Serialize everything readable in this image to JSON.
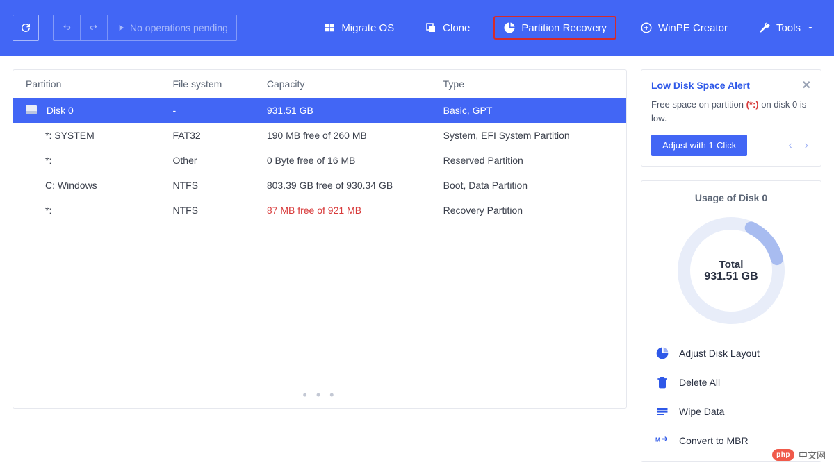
{
  "toolbar": {
    "pending": "No operations pending",
    "migrate": "Migrate OS",
    "clone": "Clone",
    "recovery": "Partition Recovery",
    "winpe": "WinPE Creator",
    "tools": "Tools"
  },
  "table": {
    "headers": {
      "partition": "Partition",
      "fs": "File system",
      "capacity": "Capacity",
      "type": "Type"
    },
    "disk": {
      "name": "Disk 0",
      "fs": "-",
      "capacity": "931.51 GB",
      "type": "Basic, GPT"
    },
    "rows": [
      {
        "name": "*: SYSTEM",
        "fs": "FAT32",
        "capacity": "190 MB free of 260 MB",
        "type": "System, EFI System Partition",
        "warn": false
      },
      {
        "name": "*:",
        "fs": "Other",
        "capacity": "0 Byte free of 16 MB",
        "type": "Reserved Partition",
        "warn": false
      },
      {
        "name": "C: Windows",
        "fs": "NTFS",
        "capacity": "803.39 GB free of 930.34 GB",
        "type": "Boot, Data Partition",
        "warn": false
      },
      {
        "name": "*:",
        "fs": "NTFS",
        "capacity": "87 MB free of 921 MB",
        "type": "Recovery Partition",
        "warn": true
      }
    ]
  },
  "alert": {
    "title": "Low Disk Space Alert",
    "prefix": "Free space on partition ",
    "highlight": "(*:)",
    "suffix": " on disk 0 is low.",
    "button": "Adjust with 1-Click"
  },
  "usage": {
    "title": "Usage of Disk 0",
    "total_label": "Total",
    "total_value": "931.51 GB"
  },
  "actions": {
    "adjust": "Adjust Disk Layout",
    "delete": "Delete All",
    "wipe": "Wipe Data",
    "mbr": "Convert to MBR"
  },
  "watermark": {
    "badge": "php",
    "text": "中文网"
  }
}
